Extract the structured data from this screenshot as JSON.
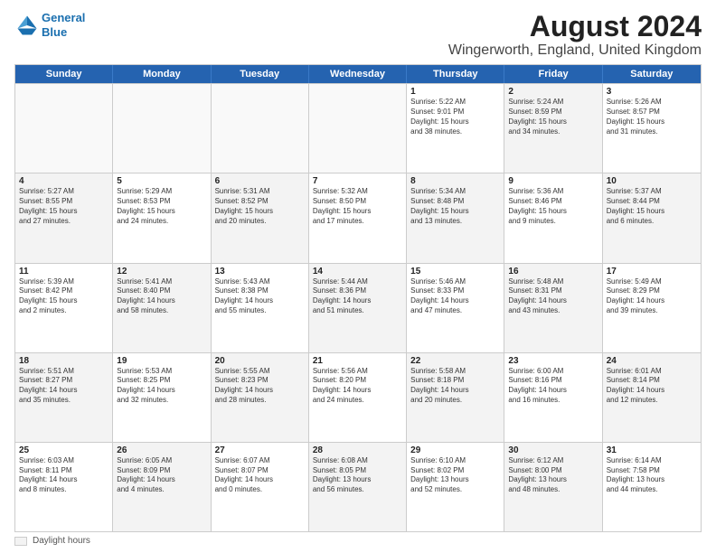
{
  "logo": {
    "line1": "General",
    "line2": "Blue"
  },
  "title": "August 2024",
  "subtitle": "Wingerworth, England, United Kingdom",
  "weekdays": [
    "Sunday",
    "Monday",
    "Tuesday",
    "Wednesday",
    "Thursday",
    "Friday",
    "Saturday"
  ],
  "legend_label": "Daylight hours",
  "rows": [
    [
      {
        "day": "",
        "lines": []
      },
      {
        "day": "",
        "lines": []
      },
      {
        "day": "",
        "lines": []
      },
      {
        "day": "",
        "lines": []
      },
      {
        "day": "1",
        "lines": [
          "Sunrise: 5:22 AM",
          "Sunset: 9:01 PM",
          "Daylight: 15 hours",
          "and 38 minutes."
        ]
      },
      {
        "day": "2",
        "lines": [
          "Sunrise: 5:24 AM",
          "Sunset: 8:59 PM",
          "Daylight: 15 hours",
          "and 34 minutes."
        ]
      },
      {
        "day": "3",
        "lines": [
          "Sunrise: 5:26 AM",
          "Sunset: 8:57 PM",
          "Daylight: 15 hours",
          "and 31 minutes."
        ]
      }
    ],
    [
      {
        "day": "4",
        "lines": [
          "Sunrise: 5:27 AM",
          "Sunset: 8:55 PM",
          "Daylight: 15 hours",
          "and 27 minutes."
        ]
      },
      {
        "day": "5",
        "lines": [
          "Sunrise: 5:29 AM",
          "Sunset: 8:53 PM",
          "Daylight: 15 hours",
          "and 24 minutes."
        ]
      },
      {
        "day": "6",
        "lines": [
          "Sunrise: 5:31 AM",
          "Sunset: 8:52 PM",
          "Daylight: 15 hours",
          "and 20 minutes."
        ]
      },
      {
        "day": "7",
        "lines": [
          "Sunrise: 5:32 AM",
          "Sunset: 8:50 PM",
          "Daylight: 15 hours",
          "and 17 minutes."
        ]
      },
      {
        "day": "8",
        "lines": [
          "Sunrise: 5:34 AM",
          "Sunset: 8:48 PM",
          "Daylight: 15 hours",
          "and 13 minutes."
        ]
      },
      {
        "day": "9",
        "lines": [
          "Sunrise: 5:36 AM",
          "Sunset: 8:46 PM",
          "Daylight: 15 hours",
          "and 9 minutes."
        ]
      },
      {
        "day": "10",
        "lines": [
          "Sunrise: 5:37 AM",
          "Sunset: 8:44 PM",
          "Daylight: 15 hours",
          "and 6 minutes."
        ]
      }
    ],
    [
      {
        "day": "11",
        "lines": [
          "Sunrise: 5:39 AM",
          "Sunset: 8:42 PM",
          "Daylight: 15 hours",
          "and 2 minutes."
        ]
      },
      {
        "day": "12",
        "lines": [
          "Sunrise: 5:41 AM",
          "Sunset: 8:40 PM",
          "Daylight: 14 hours",
          "and 58 minutes."
        ]
      },
      {
        "day": "13",
        "lines": [
          "Sunrise: 5:43 AM",
          "Sunset: 8:38 PM",
          "Daylight: 14 hours",
          "and 55 minutes."
        ]
      },
      {
        "day": "14",
        "lines": [
          "Sunrise: 5:44 AM",
          "Sunset: 8:36 PM",
          "Daylight: 14 hours",
          "and 51 minutes."
        ]
      },
      {
        "day": "15",
        "lines": [
          "Sunrise: 5:46 AM",
          "Sunset: 8:33 PM",
          "Daylight: 14 hours",
          "and 47 minutes."
        ]
      },
      {
        "day": "16",
        "lines": [
          "Sunrise: 5:48 AM",
          "Sunset: 8:31 PM",
          "Daylight: 14 hours",
          "and 43 minutes."
        ]
      },
      {
        "day": "17",
        "lines": [
          "Sunrise: 5:49 AM",
          "Sunset: 8:29 PM",
          "Daylight: 14 hours",
          "and 39 minutes."
        ]
      }
    ],
    [
      {
        "day": "18",
        "lines": [
          "Sunrise: 5:51 AM",
          "Sunset: 8:27 PM",
          "Daylight: 14 hours",
          "and 35 minutes."
        ]
      },
      {
        "day": "19",
        "lines": [
          "Sunrise: 5:53 AM",
          "Sunset: 8:25 PM",
          "Daylight: 14 hours",
          "and 32 minutes."
        ]
      },
      {
        "day": "20",
        "lines": [
          "Sunrise: 5:55 AM",
          "Sunset: 8:23 PM",
          "Daylight: 14 hours",
          "and 28 minutes."
        ]
      },
      {
        "day": "21",
        "lines": [
          "Sunrise: 5:56 AM",
          "Sunset: 8:20 PM",
          "Daylight: 14 hours",
          "and 24 minutes."
        ]
      },
      {
        "day": "22",
        "lines": [
          "Sunrise: 5:58 AM",
          "Sunset: 8:18 PM",
          "Daylight: 14 hours",
          "and 20 minutes."
        ]
      },
      {
        "day": "23",
        "lines": [
          "Sunrise: 6:00 AM",
          "Sunset: 8:16 PM",
          "Daylight: 14 hours",
          "and 16 minutes."
        ]
      },
      {
        "day": "24",
        "lines": [
          "Sunrise: 6:01 AM",
          "Sunset: 8:14 PM",
          "Daylight: 14 hours",
          "and 12 minutes."
        ]
      }
    ],
    [
      {
        "day": "25",
        "lines": [
          "Sunrise: 6:03 AM",
          "Sunset: 8:11 PM",
          "Daylight: 14 hours",
          "and 8 minutes."
        ]
      },
      {
        "day": "26",
        "lines": [
          "Sunrise: 6:05 AM",
          "Sunset: 8:09 PM",
          "Daylight: 14 hours",
          "and 4 minutes."
        ]
      },
      {
        "day": "27",
        "lines": [
          "Sunrise: 6:07 AM",
          "Sunset: 8:07 PM",
          "Daylight: 14 hours",
          "and 0 minutes."
        ]
      },
      {
        "day": "28",
        "lines": [
          "Sunrise: 6:08 AM",
          "Sunset: 8:05 PM",
          "Daylight: 13 hours",
          "and 56 minutes."
        ]
      },
      {
        "day": "29",
        "lines": [
          "Sunrise: 6:10 AM",
          "Sunset: 8:02 PM",
          "Daylight: 13 hours",
          "and 52 minutes."
        ]
      },
      {
        "day": "30",
        "lines": [
          "Sunrise: 6:12 AM",
          "Sunset: 8:00 PM",
          "Daylight: 13 hours",
          "and 48 minutes."
        ]
      },
      {
        "day": "31",
        "lines": [
          "Sunrise: 6:14 AM",
          "Sunset: 7:58 PM",
          "Daylight: 13 hours",
          "and 44 minutes."
        ]
      }
    ]
  ]
}
